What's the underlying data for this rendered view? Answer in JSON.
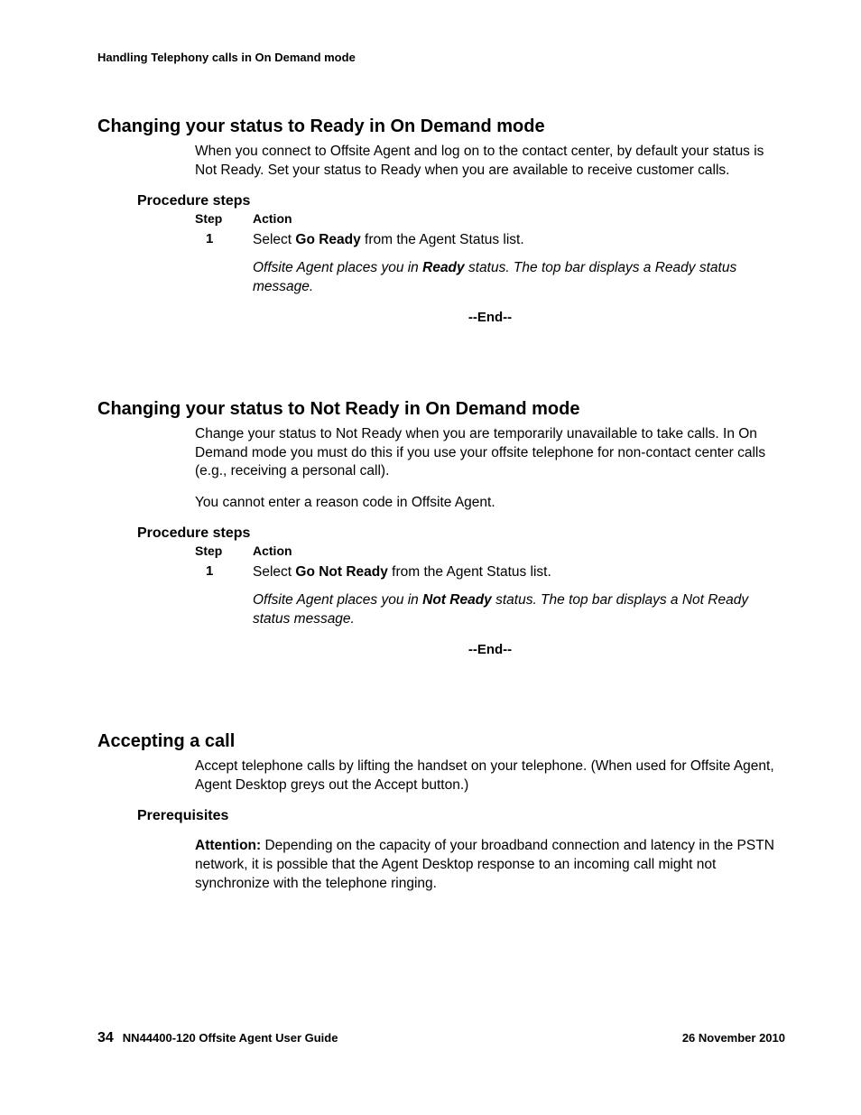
{
  "header": "Handling Telephony calls in On Demand mode",
  "sections": {
    "s1": {
      "title": "Changing your status to Ready in On Demand mode",
      "intro": "When you connect to Offsite Agent and log on to the contact center, by default your status is Not Ready. Set your status to Ready when you are available to receive customer calls.",
      "procLabel": "Procedure steps",
      "stepHead": "Step",
      "actionHead": "Action",
      "step1num": "1",
      "step1_pre": "Select ",
      "step1_bold": "Go Ready",
      "step1_post": " from the Agent Status list.",
      "result_pre": "Offsite Agent places you in ",
      "result_bold": "Ready",
      "result_post": " status. The top bar displays a Ready status message.",
      "end": "--End--"
    },
    "s2": {
      "title": "Changing your status to Not Ready in On Demand mode",
      "intro1": "Change your status to Not Ready when you are temporarily unavailable to take calls. In On Demand mode you must do this if you use your offsite telephone for non-contact center calls (e.g., receiving a personal call).",
      "intro2": "You cannot enter a reason code in Offsite Agent.",
      "procLabel": "Procedure steps",
      "stepHead": "Step",
      "actionHead": "Action",
      "step1num": "1",
      "step1_pre": "Select ",
      "step1_bold": "Go Not Ready",
      "step1_post": " from the Agent Status list.",
      "result_pre": "Offsite Agent places you in ",
      "result_bold": "Not Ready",
      "result_post": " status. The top bar displays a Not Ready status message.",
      "end": "--End--"
    },
    "s3": {
      "title": "Accepting a call",
      "intro": "Accept telephone calls by lifting the handset on your telephone. (When used for Offsite Agent, Agent Desktop greys out the Accept button.)",
      "prereqLabel": "Prerequisites",
      "attnLabel": "Attention:",
      "attnBody": "  Depending on the capacity of your broadband connection and latency in the PSTN network, it is possible that the Agent Desktop response to an incoming call might not synchronize with the telephone ringing."
    }
  },
  "footer": {
    "pageNum": "34",
    "docTitle": "NN44400-120 Offsite Agent User Guide",
    "date": "26 November 2010"
  }
}
